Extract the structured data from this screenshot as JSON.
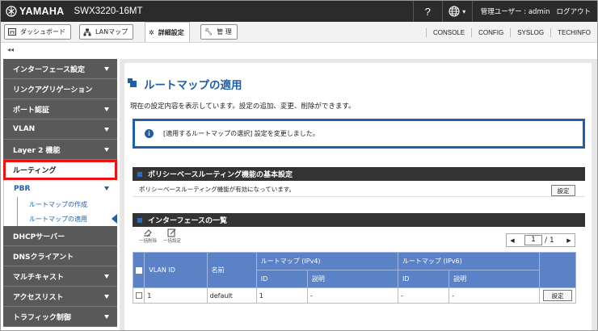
{
  "header": {
    "brand": "YAMAHA",
    "model": "SWX3220-16MT",
    "help": "?",
    "user": "管理ユーザー : admin",
    "logout": "ログアウト"
  },
  "nav": {
    "tabs": [
      {
        "label": "ダッシュボード",
        "icon": "dashboard-icon"
      },
      {
        "label": "LANマップ",
        "icon": "lanmap-icon"
      },
      {
        "label": "詳細設定",
        "icon": "gear-icon"
      },
      {
        "label": "管 理",
        "icon": "wrench-icon"
      }
    ],
    "links": [
      "CONSOLE",
      "CONFIG",
      "SYSLOG",
      "TECHINFO"
    ],
    "collapse": "◂◂"
  },
  "sidebar": {
    "items": [
      {
        "label": "インターフェース設定"
      },
      {
        "label": "リンクアグリゲーション"
      },
      {
        "label": "ポート認証"
      },
      {
        "label": "VLAN"
      },
      {
        "label": "Layer 2 機能"
      },
      {
        "label": "ルーティング"
      },
      {
        "label": "DHCPサーバー"
      },
      {
        "label": "DNSクライアント"
      },
      {
        "label": "マルチキャスト"
      },
      {
        "label": "アクセスリスト"
      },
      {
        "label": "トラフィック制御"
      }
    ],
    "sub": {
      "group": "PBR",
      "leaves": [
        "ルートマップの作成",
        "ルートマップの適用"
      ]
    }
  },
  "page": {
    "title": "ルートマップの適用",
    "description": "現在の設定内容を表示しています。設定の追加、変更、削除ができます。",
    "notice": "[適用するルートマップの選択] 設定を変更しました。",
    "section1": {
      "title": "ポリシーベースルーティング機能の基本設定",
      "status": "ポリシーベースルーティング機能が有効になっています。",
      "button": "設定"
    },
    "section2": {
      "title": "インターフェースの一覧",
      "bulk_delete": "一括削除",
      "bulk_set": "一括設定",
      "pager": {
        "current": "1",
        "separator": "/",
        "total": "1"
      },
      "table": {
        "headers": {
          "vlan_id": "VLAN ID",
          "name": "名前",
          "ipv4": "ルートマップ (IPv4)",
          "ipv6": "ルートマップ (IPv6)",
          "id": "ID",
          "desc": "説明"
        },
        "rows": [
          {
            "vlan_id": "1",
            "name": "default",
            "v4_id": "1",
            "v4_desc": "-",
            "v6_id": "-",
            "v6_desc": "-",
            "button": "設定"
          }
        ]
      }
    }
  }
}
